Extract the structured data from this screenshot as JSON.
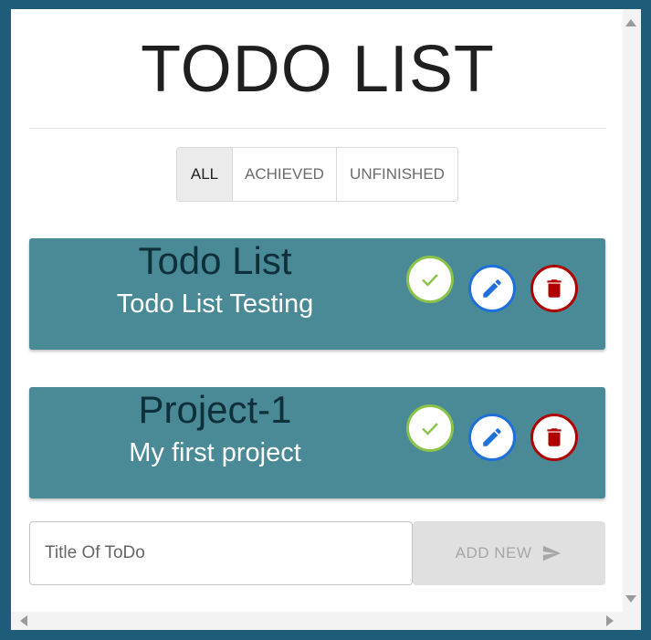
{
  "app": {
    "title": "TODO LIST"
  },
  "filters": [
    {
      "label": "ALL",
      "active": true
    },
    {
      "label": "ACHIEVED",
      "active": false
    },
    {
      "label": "UNFINISHED",
      "active": false
    }
  ],
  "todos": [
    {
      "title": "Todo List",
      "description": "Todo List Testing"
    },
    {
      "title": "Project-1",
      "description": "My first project"
    }
  ],
  "add_form": {
    "placeholder": "Title Of ToDo",
    "value": "",
    "button_label": "ADD NEW"
  },
  "icons": {
    "done": "check-icon",
    "edit": "pencil-icon",
    "delete": "trash-icon",
    "send": "send-icon"
  },
  "colors": {
    "background": "#1f5c7a",
    "card": "#4a8a96",
    "card_title": "#0f2f3a",
    "done_accent": "#8bc34a",
    "edit_accent": "#1e6fd9",
    "delete_accent": "#b00000",
    "add_button_bg": "#e0e0e0"
  }
}
